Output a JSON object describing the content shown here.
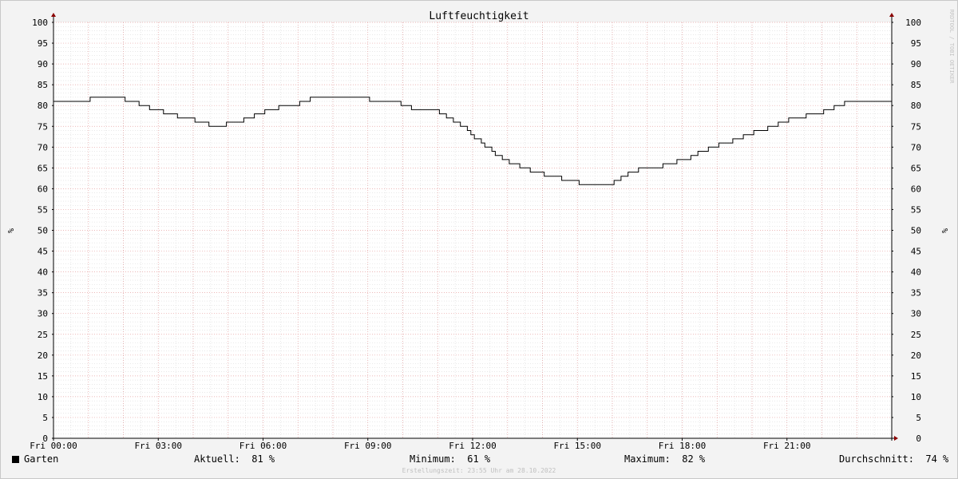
{
  "chart_data": {
    "type": "line",
    "title": "Luftfeuchtigkeit",
    "ylabel": "%",
    "ylim": [
      0,
      100
    ],
    "y_ticks": [
      "0",
      "5",
      "10",
      "15",
      "20",
      "25",
      "30",
      "35",
      "40",
      "45",
      "50",
      "55",
      "60",
      "65",
      "70",
      "75",
      "80",
      "85",
      "90",
      "95",
      "100"
    ],
    "x_ticks": [
      "Fri 00:00",
      "Fri 03:00",
      "Fri 06:00",
      "Fri 09:00",
      "Fri 12:00",
      "Fri 15:00",
      "Fri 18:00",
      "Fri 21:00"
    ],
    "x_range_hours": [
      0,
      24
    ],
    "grid": true,
    "series": [
      {
        "name": "Garten",
        "color": "#000000",
        "x_hours": [
          0,
          1.05,
          2.05,
          2.45,
          2.75,
          3.15,
          3.55,
          4.05,
          4.45,
          4.95,
          5.45,
          5.75,
          6.05,
          6.45,
          7.05,
          7.35,
          7.55,
          7.95,
          8.25,
          9.05,
          9.35,
          9.95,
          10.25,
          10.55,
          11.05,
          11.25,
          11.45,
          11.65,
          11.85,
          11.95,
          12.05,
          12.25,
          12.35,
          12.55,
          12.65,
          12.85,
          13.05,
          13.35,
          13.65,
          14.05,
          14.55,
          15.05,
          15.55,
          16.05,
          16.25,
          16.45,
          16.75,
          17.05,
          17.45,
          17.85,
          18.25,
          18.45,
          18.75,
          19.05,
          19.45,
          19.75,
          20.05,
          20.45,
          20.75,
          21.05,
          21.55,
          22.05,
          22.35,
          22.65,
          22.95,
          23.25
        ],
        "values": [
          81,
          82,
          81,
          80,
          79,
          78,
          77,
          76,
          75,
          76,
          77,
          78,
          79,
          80,
          81,
          82,
          82,
          82,
          82,
          81,
          81,
          80,
          79,
          79,
          78,
          77,
          76,
          75,
          74,
          73,
          72,
          71,
          70,
          69,
          68,
          67,
          66,
          65,
          64,
          63,
          62,
          61,
          61,
          62,
          63,
          64,
          65,
          65,
          66,
          67,
          68,
          69,
          70,
          71,
          72,
          73,
          74,
          75,
          76,
          77,
          78,
          79,
          80,
          81,
          81,
          81
        ]
      }
    ],
    "legend": {
      "series_name": "Garten",
      "aktuell_label": "Aktuell:",
      "aktuell_value": "81 %",
      "minimum_label": "Minimum:",
      "minimum_value": "61 %",
      "maximum_label": "Maximum:",
      "maximum_value": "82 %",
      "durchschnitt_label": "Durchschnitt:",
      "durchschnitt_value": "74 %"
    }
  },
  "watermark": "RRDTOOL / TOBI OETIKER",
  "footer": "Erstellungszeit: 23:55 Uhr am 28.10.2022",
  "colors": {
    "major_grid": "#e6a0a0",
    "minor_grid": "#d2d2d2",
    "line": "#000000",
    "axis": "#000000",
    "arrow": "#8b0000",
    "background": "#f3f3f3",
    "plot_background": "#ffffff"
  }
}
